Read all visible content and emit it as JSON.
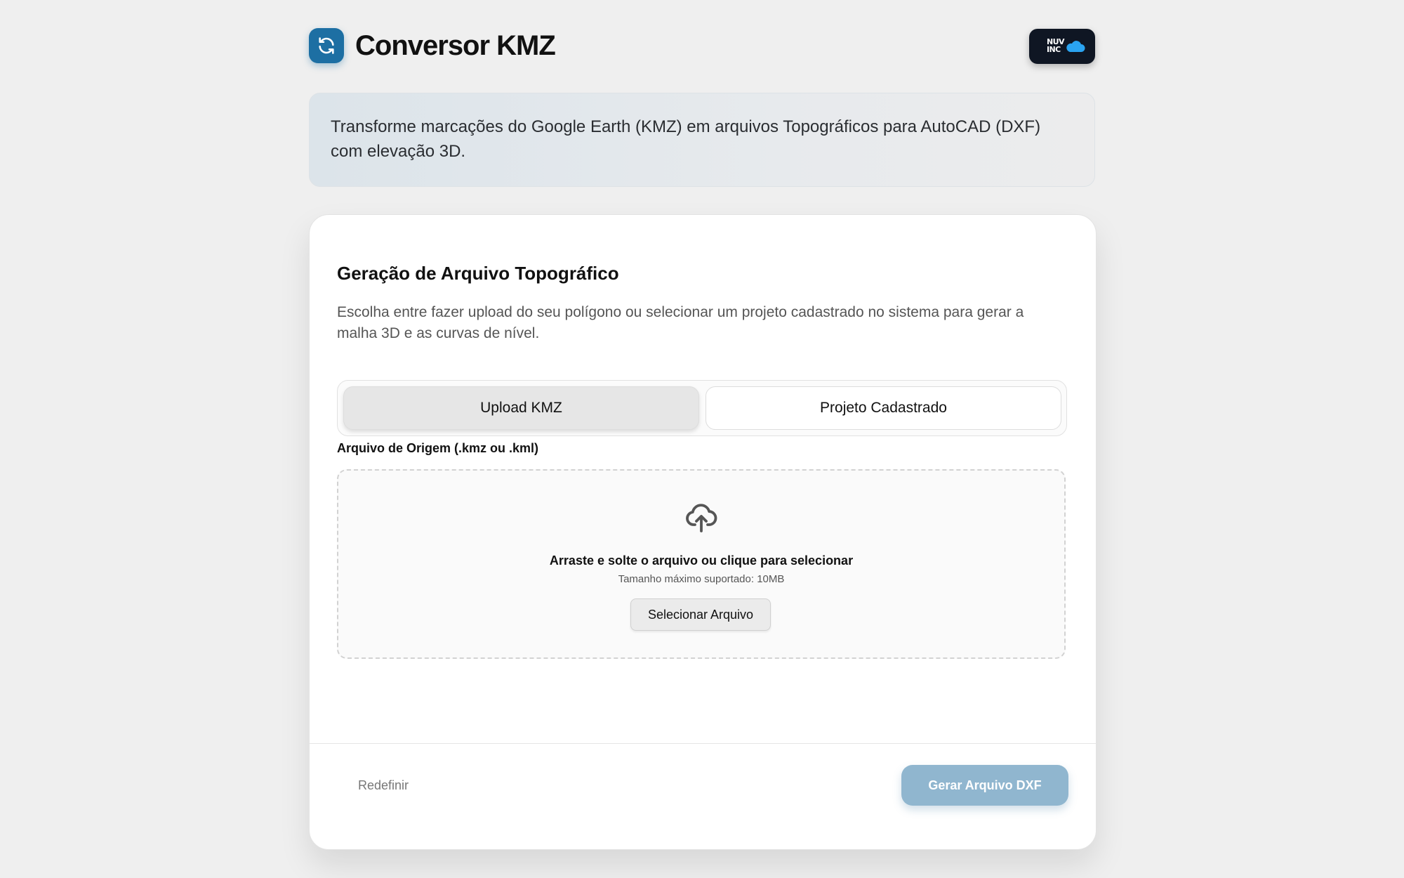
{
  "header": {
    "title": "Conversor KMZ",
    "brand_badge": {
      "line1": "NUV",
      "line2": "INC"
    }
  },
  "intro": {
    "text": "Transforme marcações do Google Earth (KMZ) em arquivos Topográficos para AutoCAD (DXF) com elevação 3D."
  },
  "card": {
    "title": "Geração de Arquivo Topográfico",
    "description": "Escolha entre fazer upload do seu polígono ou selecionar um projeto cadastrado no sistema para gerar a malha 3D e as curvas de nível.",
    "tabs": [
      {
        "label": "Upload KMZ",
        "active": true
      },
      {
        "label": "Projeto Cadastrado",
        "active": false
      }
    ],
    "field_label": "Arquivo de Origem (.kmz ou .kml)",
    "dropzone": {
      "icon": "cloud-upload-icon",
      "title": "Arraste e solte o arquivo ou clique para selecionar",
      "hint": "Tamanho máximo suportado: 10MB",
      "button_label": "Selecionar Arquivo"
    },
    "footer": {
      "reset_label": "Redefinir",
      "generate_label": "Gerar Arquivo DXF"
    }
  },
  "colors": {
    "accent": "#1d6fa3",
    "generate_button": "#90b6cf",
    "brand_badge": "#0f1623",
    "brand_cloud": "#2aa3f0"
  },
  "icons": {
    "app_logo": "refresh-icon",
    "brand": "cloud-icon",
    "dropzone": "cloud-upload-icon"
  }
}
